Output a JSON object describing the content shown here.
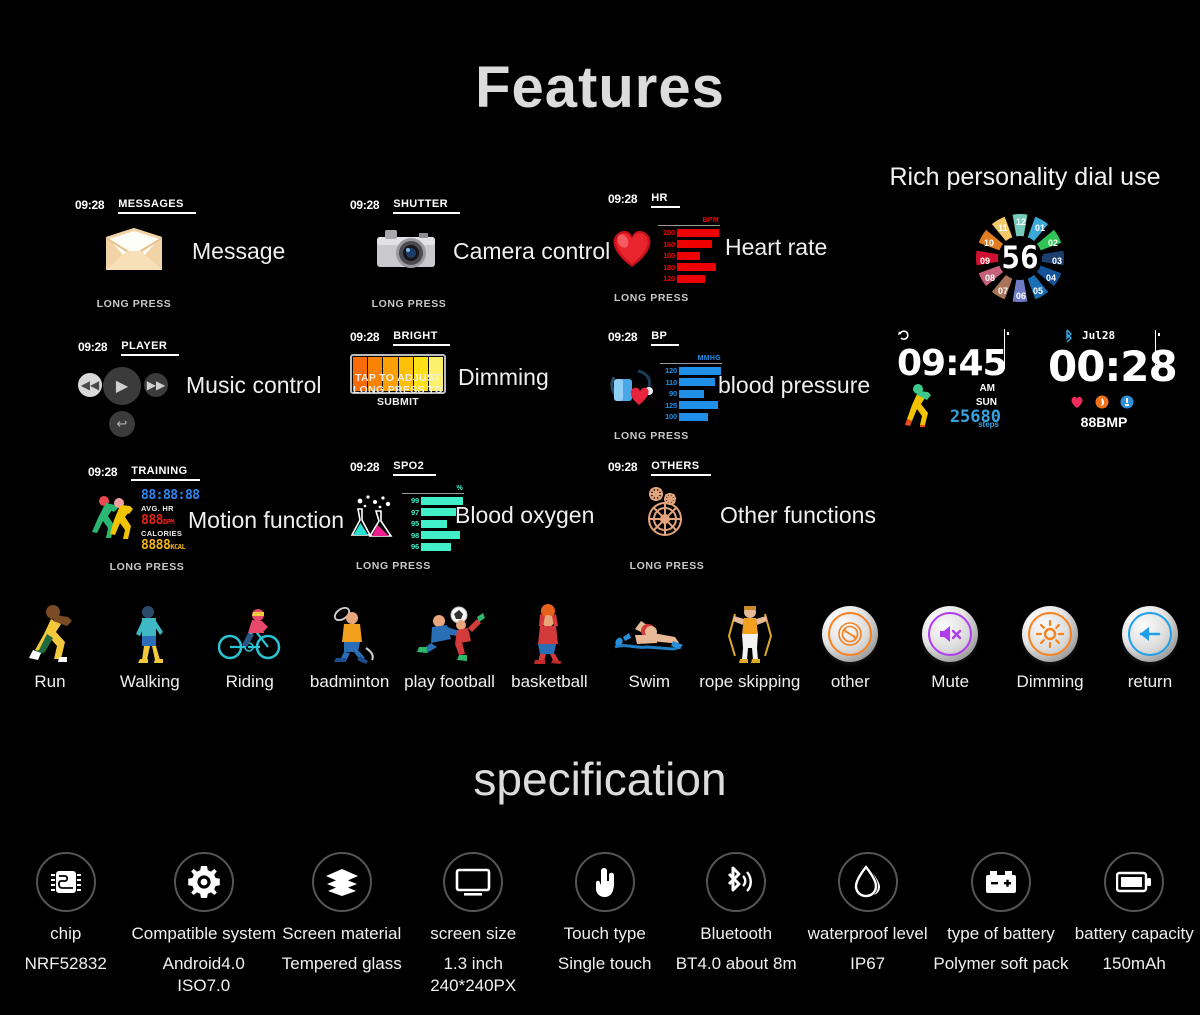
{
  "headings": {
    "features": "Features",
    "specification": "specification",
    "rich_dial": "Rich personality dial use"
  },
  "common": {
    "time": "09:28",
    "long_press": "LONG PRESS"
  },
  "features": [
    {
      "id": "message",
      "mode": "MESSAGES",
      "label": "Message",
      "footer": "LONG PRESS",
      "icon": "envelope-icon"
    },
    {
      "id": "camera",
      "mode": "SHUTTER",
      "label": "Camera control",
      "footer": "LONG PRESS",
      "icon": "camera-icon"
    },
    {
      "id": "heart-rate",
      "mode": "HR",
      "label": "Heart rate",
      "footer": "LONG PRESS",
      "icon": "heart-icon",
      "chart": {
        "unit": "BPM",
        "color": "#ee0000",
        "text_color": "#ee0000",
        "values": [
          200,
          160,
          100,
          180,
          120
        ],
        "widths": [
          100,
          84,
          56,
          92,
          66
        ]
      }
    },
    {
      "id": "music",
      "mode": "PLAYER",
      "label": "Music control",
      "footer": "",
      "icon": "music-player-icon",
      "buttons": [
        "prev",
        "play",
        "next",
        "back"
      ]
    },
    {
      "id": "dimming",
      "mode": "BRIGHT",
      "label": "Dimming",
      "footer": "TAP TO ADJUST",
      "footer2": "LONG PRESS TO SUBMIT",
      "icon": "brightness-bar-icon",
      "segments": [
        "#f86b05",
        "#fb8303",
        "#fda003",
        "#fdc006",
        "#fde017",
        "#fdf06a"
      ]
    },
    {
      "id": "blood-pressure",
      "mode": "BP",
      "label": "blood pressure",
      "footer": "LONG PRESS",
      "icon": "blood-pressure-monitor-icon",
      "chart": {
        "unit": "MMHG",
        "color": "#1f8fe8",
        "text_color": "#1f8fe8",
        "values": [
          120,
          110,
          90,
          125,
          100
        ],
        "widths": [
          100,
          86,
          60,
          94,
          70
        ]
      }
    },
    {
      "id": "motion",
      "mode": "TRAINING",
      "label": "Motion function",
      "footer": "LONG PRESS",
      "icon": "runners-icon",
      "training": {
        "duration": "88:88:88",
        "hr_caption": "AVG. HR",
        "hr_value": "888",
        "hr_unit": "BPM",
        "cal_caption": "CALORIES",
        "cal_value": "8888",
        "cal_unit": "KCAL"
      }
    },
    {
      "id": "blood-oxygen",
      "mode": "SPO2",
      "label": "Blood oxygen",
      "footer": "LONG PRESS",
      "icon": "flasks-icon",
      "chart": {
        "unit": "%",
        "color": "#41f0c8",
        "text_color": "#41f0c8",
        "values": [
          99,
          97,
          95,
          98,
          96
        ],
        "widths": [
          100,
          84,
          62,
          92,
          72
        ]
      }
    },
    {
      "id": "others",
      "mode": "OTHERS",
      "label": "Other functions",
      "footer": "LONG PRESS",
      "icon": "gears-icon"
    }
  ],
  "watch_faces": {
    "dial": {
      "center": "56",
      "numbers": [
        "12",
        "01",
        "02",
        "03",
        "04",
        "05",
        "06",
        "07",
        "08",
        "09",
        "10",
        "11"
      ],
      "colors": [
        "#76cdbb",
        "#3aa9d8",
        "#2fc255",
        "#1d3f6e",
        "#12539a",
        "#1a6fb5",
        "#6f7bc4",
        "#a9745a",
        "#c6607a",
        "#cf1030",
        "#e07c22",
        "#f4c96a"
      ],
      "highlight_index": 2,
      "highlight_color": "#2fc255"
    },
    "face_steps": {
      "time": "09:45",
      "ampm": "AM",
      "day": "SUN",
      "steps": "25680",
      "steps_label": "steps",
      "icons": [
        "sync-icon",
        "battery-icon",
        "runner-icon"
      ]
    },
    "face_hr": {
      "time": "00:28",
      "date": "Jul28",
      "bmp": "88BMP",
      "icons": [
        "bluetooth-icon",
        "battery-icon",
        "heart-icon",
        "flame-icon",
        "shoe-icon"
      ]
    }
  },
  "sports": [
    {
      "label": "Run",
      "icon": "running-icon"
    },
    {
      "label": "Walking",
      "icon": "walking-icon"
    },
    {
      "label": "Riding",
      "icon": "cycling-icon"
    },
    {
      "label": "badminton",
      "icon": "badminton-icon"
    },
    {
      "label": "play football",
      "icon": "football-icon"
    },
    {
      "label": "basketball",
      "icon": "basketball-icon"
    },
    {
      "label": "Swim",
      "icon": "swimming-icon"
    },
    {
      "label": "rope skipping",
      "icon": "jump-rope-icon"
    }
  ],
  "controls": [
    {
      "label": "other",
      "icon": "other-refresh-icon",
      "color": "#f58220"
    },
    {
      "label": "Mute",
      "icon": "mute-icon",
      "color": "#b03cf0"
    },
    {
      "label": "Dimming",
      "icon": "brightness-sun-icon",
      "color": "#f58220"
    },
    {
      "label": "return",
      "icon": "back-arrow-icon",
      "color": "#1f9fe8"
    }
  ],
  "specs": [
    {
      "icon": "chip-icon",
      "name": "chip",
      "value": "NRF52832"
    },
    {
      "icon": "gear-icon",
      "name": "Compatible system",
      "value": "Android4.0\nISO7.0"
    },
    {
      "icon": "layers-icon",
      "name": "Screen material",
      "value": "Tempered glass"
    },
    {
      "icon": "monitor-icon",
      "name": "screen size",
      "value": "1.3 inch\n240*240PX"
    },
    {
      "icon": "touch-hand-icon",
      "name": "Touch type",
      "value": "Single touch"
    },
    {
      "icon": "bluetooth-icon",
      "name": "Bluetooth",
      "value": "BT4.0  about 8m"
    },
    {
      "icon": "water-drop-icon",
      "name": "waterproof level",
      "value": "IP67"
    },
    {
      "icon": "car-battery-icon",
      "name": "type of battery",
      "value": "Polymer soft pack"
    },
    {
      "icon": "battery-icon",
      "name": "battery capacity",
      "value": "150mAh"
    }
  ]
}
